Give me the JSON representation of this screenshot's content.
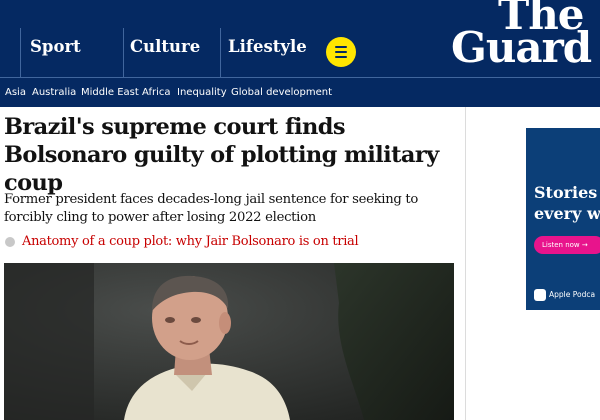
{
  "header": {
    "pillars": [
      {
        "label": "Sport"
      },
      {
        "label": "Culture"
      },
      {
        "label": "Lifestyle"
      }
    ],
    "menu_icon": "hamburger-menu-icon",
    "logo": {
      "line1": "The",
      "line2": "Guard"
    }
  },
  "subnav": {
    "items": [
      "Asia",
      "Australia",
      "Middle East",
      "Africa",
      "Inequality",
      "Global development"
    ]
  },
  "article": {
    "headline": "Brazil's supreme court finds Bolsonaro guilty of plotting military coup",
    "standfirst": "Former president faces decades-long jail sentence for seeking to forcibly cling to power after losing 2022 election",
    "related_link": "Anatomy of a coup plot: why Jair Bolsonaro is on trial"
  },
  "ad": {
    "title_line1": "Stories",
    "title_line2": "every w",
    "button_label": "Listen now →",
    "platform_label": "Apple Podca"
  },
  "colors": {
    "brand_navy": "#052962",
    "menu_yellow": "#ffe500",
    "link_red": "#c70000",
    "ad_pink": "#e8148c"
  }
}
